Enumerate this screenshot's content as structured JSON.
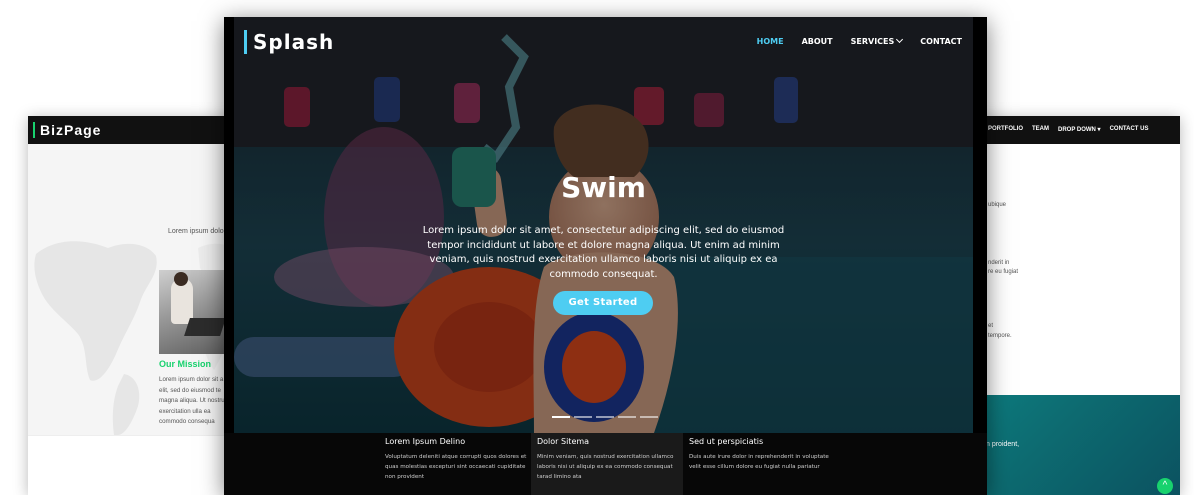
{
  "left_card": {
    "brand": "BizPage",
    "intro_text": "Lorem ipsum dolo",
    "mission_title": "Our Mission",
    "mission_text": "Lorem ipsum dolor sit a elit, sed do eiusmod te magna aliqua. Ut nostrud exercitation ulla ea commodo consequa"
  },
  "right_card": {
    "nav": [
      "PORTFOLIO",
      "TEAM",
      "DROP DOWN",
      "CONTACT US"
    ],
    "snippets": [
      "ubique",
      "nderit in",
      "re eu fugiat",
      "et",
      "tempore."
    ],
    "teal_text": "n proident,",
    "scroll_top_icon": "^"
  },
  "main_card": {
    "logo": "Splash",
    "nav": {
      "home": "HOME",
      "about": "ABOUT",
      "services": "SERVICES",
      "contact": "CONTACT"
    },
    "hero_title": "Swim",
    "hero_text": "Lorem ipsum dolor sit amet, consectetur adipiscing elit, sed do eiusmod tempor incididunt ut labore et dolore magna aliqua. Ut enim ad minim veniam, quis nostrud exercitation ullamco laboris nisi ut aliquip ex ea commodo consequat.",
    "cta_label": "Get Started",
    "slides": 5,
    "active_slide": 1,
    "accent_color": "#4ecdf2",
    "footer": [
      {
        "title": "Lorem Ipsum Delino",
        "text": "Voluptatum deleniti atque corrupti quos dolores et quas molestias excepturi sint occaecati cupiditate non provident"
      },
      {
        "title": "Dolor Sitema",
        "text": "Minim veniam, quis nostrud exercitation ullamco laboris nisi ut aliquip ex ea commodo consequat tarad limino ata"
      },
      {
        "title": "Sed ut perspiciatis",
        "text": "Duis aute irure dolor in reprehenderit in voluptate velit esse cillum dolore eu fugiat nulla pariatur"
      }
    ]
  }
}
